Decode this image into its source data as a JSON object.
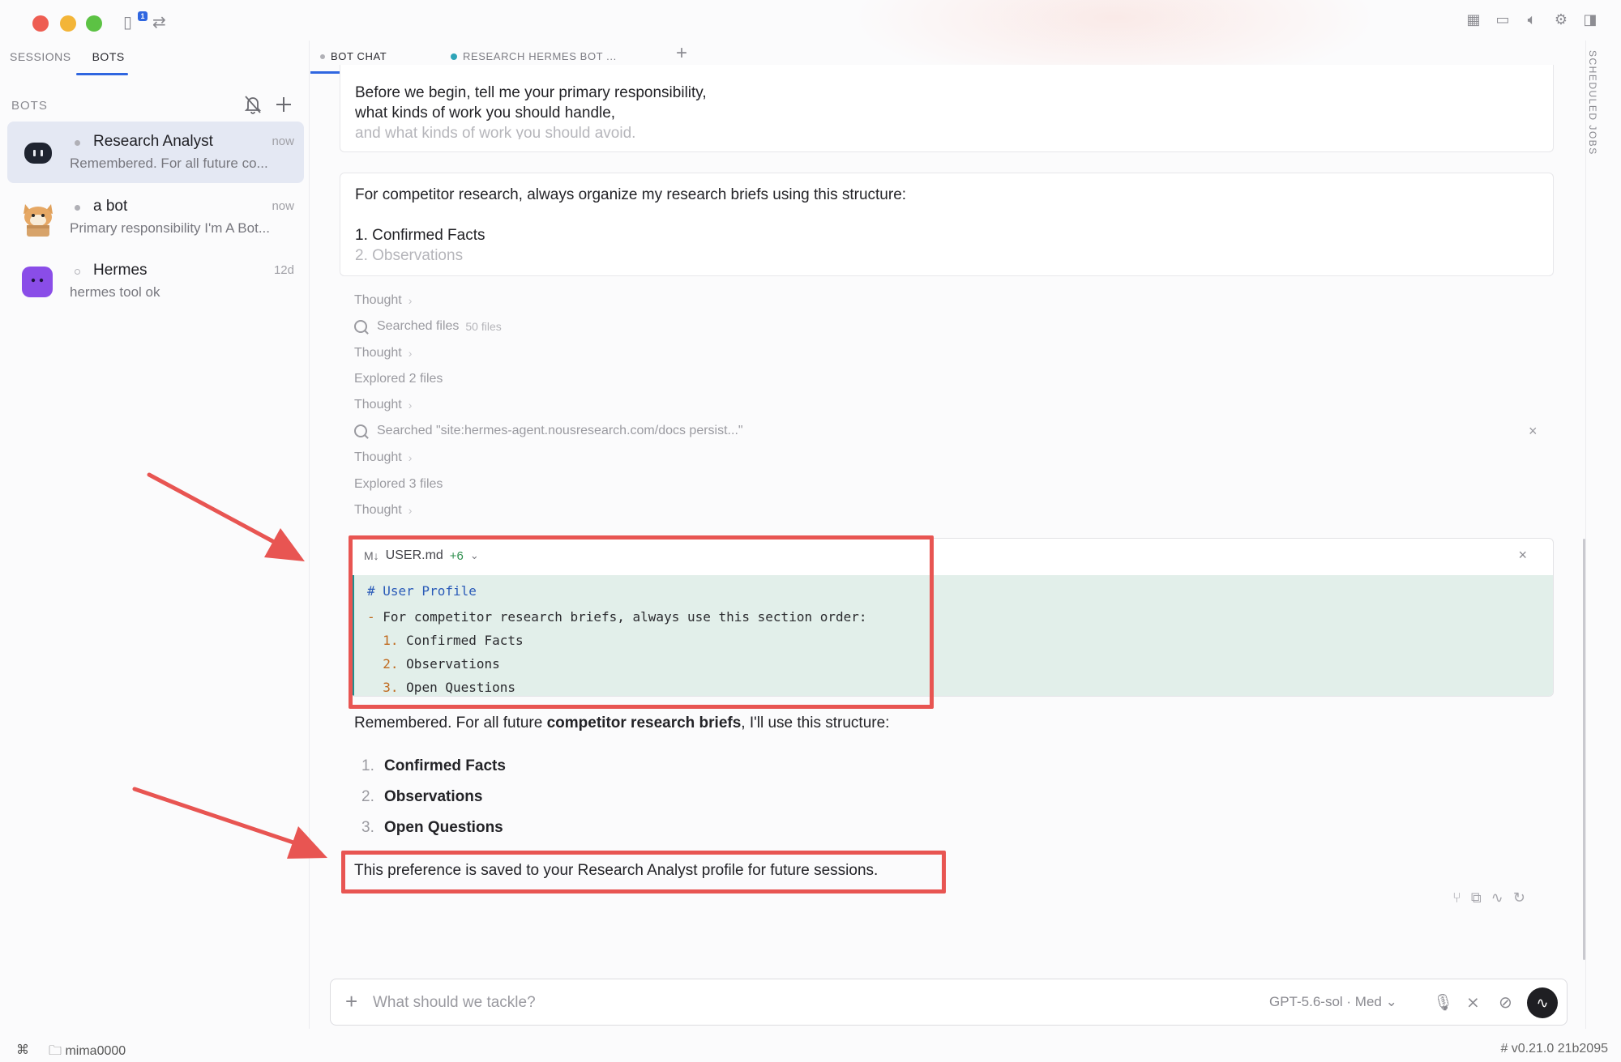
{
  "sidebar": {
    "tabs": [
      "SESSIONS",
      "BOTS"
    ],
    "section_title": "BOTS",
    "bots": [
      {
        "name": "Research Analyst",
        "time": "now",
        "preview": "Remembered. For all future co..."
      },
      {
        "name": "a bot",
        "time": "now",
        "preview": "Primary responsibility I'm A Bot..."
      },
      {
        "name": "Hermes",
        "time": "12d",
        "preview": "hermes tool ok"
      }
    ]
  },
  "main": {
    "tabs": [
      "BOT CHAT",
      "RESEARCH HERMES BOT ..."
    ],
    "right_rail_label": "SCHEDULED JOBS",
    "msg1": {
      "line1": "Before we begin, tell me your primary responsibility,",
      "line2": "what kinds of work you should handle,",
      "line3": "and what kinds of work you should avoid."
    },
    "msg2": {
      "line1": "For competitor research, always organize my research briefs using this structure:",
      "line2": "1. Confirmed Facts",
      "line3": "2. Observations"
    },
    "tool_rows": [
      {
        "label": "Thought"
      },
      {
        "label": "Searched files",
        "meta": "50 files"
      },
      {
        "label": "Thought"
      },
      {
        "label": "Explored 2 files"
      },
      {
        "label": "Thought"
      },
      {
        "label": "Searched \"site:hermes-agent.nousresearch.com/docs persist...\""
      },
      {
        "label": "Thought"
      },
      {
        "label": "Explored 3 files"
      },
      {
        "label": "Thought"
      }
    ],
    "diff": {
      "file_icon": "M↓",
      "filename": "USER.md",
      "additions": "+6",
      "lines": [
        "# User Profile",
        "For competitor research briefs, always use this section order:",
        "Confirmed Facts",
        "Observations",
        "Open Questions"
      ],
      "bullet": "-",
      "nums": [
        "1.",
        "2.",
        "3."
      ]
    },
    "answer": {
      "intro_pre": "Remembered. For all future ",
      "intro_bold": "competitor research briefs",
      "intro_post": ", I'll use this structure:",
      "items": [
        "Confirmed Facts",
        "Observations",
        "Open Questions"
      ],
      "nums": [
        "1.",
        "2.",
        "3."
      ],
      "closing": "This preference is saved to your Research Analyst profile for future sessions."
    },
    "composer": {
      "placeholder": "What should we tackle?",
      "model": "GPT-5.6-sol · Med"
    }
  },
  "statusbar": {
    "folder": "mima0000",
    "version": "# v0.21.0 21b2095"
  },
  "colors": {
    "accent": "#2f66e0",
    "annotation_red": "#e85552",
    "diff_bg": "#e2efea",
    "diff_bar": "#1e8f8f"
  }
}
